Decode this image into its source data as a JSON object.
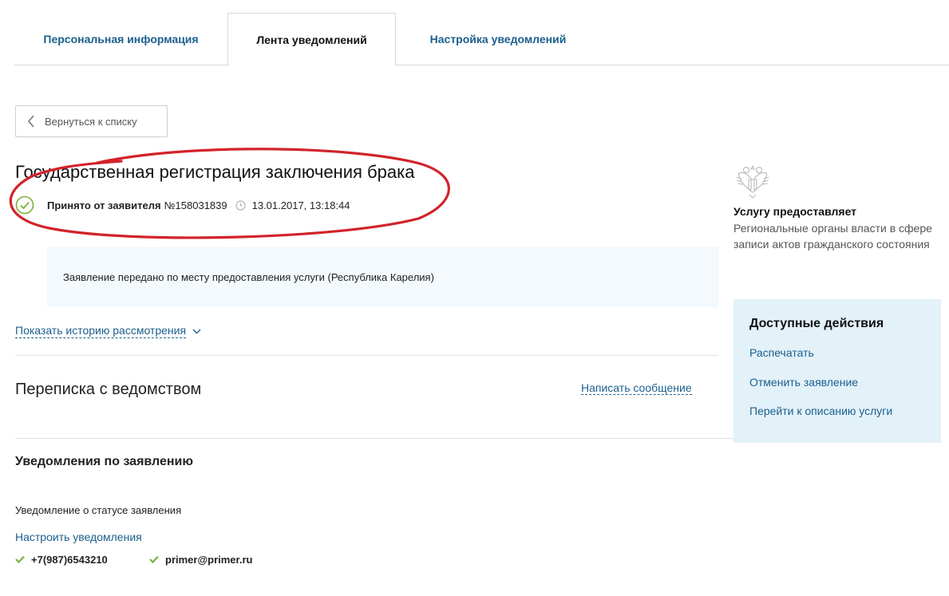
{
  "tabs": [
    {
      "label": "Персональная информация"
    },
    {
      "label": "Лента уведомлений",
      "active": true
    },
    {
      "label": "Настройка уведомлений"
    }
  ],
  "back_button": {
    "label": "Вернуться к списку",
    "icon": "chevron-left-icon"
  },
  "application": {
    "title": "Государственная регистрация заключения брака",
    "status_label": "Принято от заявителя",
    "number": "№158031839",
    "datetime": "13.01.2017, 13:18:44",
    "message": "Заявление передано по месту предоставления услуги (Республика Карелия)"
  },
  "history_link": "Показать историю рассмотрения",
  "correspondence": {
    "title": "Переписка с ведомством",
    "write_link": "Написать сообщение"
  },
  "notifications": {
    "title": "Уведомления по заявлению",
    "subtitle": "Уведомление о статусе заявления",
    "settings_link": "Настроить уведомления",
    "contacts": [
      "+7(987)6543210",
      "primer@primer.ru"
    ]
  },
  "provider": {
    "label": "Услугу предоставляет",
    "name": "Региональные органы власти в сфере записи актов гражданского состояния"
  },
  "actions": {
    "title": "Доступные действия",
    "items": [
      "Распечатать",
      "Отменить заявление",
      "Перейти к описанию услуги"
    ]
  },
  "colors": {
    "link": "#1b5f8c",
    "success": "#7bb13c",
    "annotation": "#d2232a",
    "info_bg": "#f3f9fc",
    "actions_bg": "#e3f1f9"
  }
}
